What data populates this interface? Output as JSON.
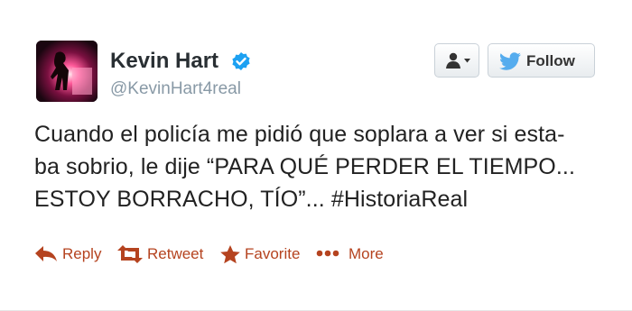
{
  "user": {
    "name": "Kevin Hart",
    "handle": "@KevinHart4real"
  },
  "buttons": {
    "follow_label": "Follow"
  },
  "tweet": {
    "lines": [
      "Cuando el policía me pidió que soplara a ver si esta-",
      "ba sobrio, le dije “PARA QUÉ PERDER EL TIEMPO...",
      "ESTOY BORRACHO, TÍO”... #HistoriaReal"
    ]
  },
  "actions": {
    "reply": "Reply",
    "retweet": "Retweet",
    "favorite": "Favorite",
    "more": "More"
  },
  "colors": {
    "action": "#b5431f",
    "verified": "#1da1f2",
    "twitter_bird": "#55acee"
  },
  "icons": {
    "verified": "verified-badge-icon",
    "user_menu": "user-dropdown-icon",
    "bird": "twitter-bird-icon",
    "reply": "reply-arrow-icon",
    "retweet": "retweet-icon",
    "favorite": "star-icon",
    "more": "ellipsis-icon"
  }
}
